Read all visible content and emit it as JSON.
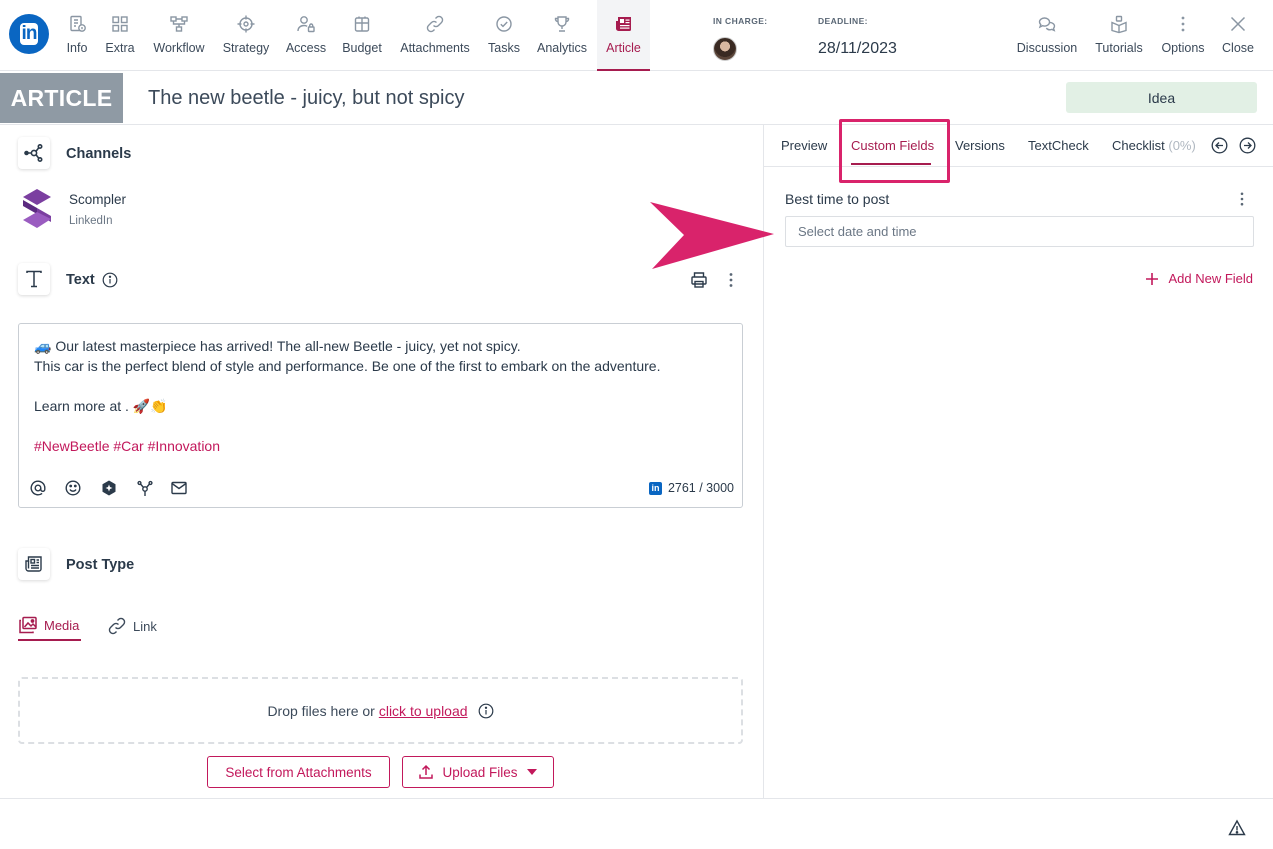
{
  "colors": {
    "accent": "#a61c4f",
    "pink": "#c2185b",
    "highlight": "#d9236b",
    "linkedin": "#0a66c2",
    "status_bg": "#e2f0e5",
    "badge_bg": "#8f9aa4"
  },
  "toolbar": {
    "logo_icon": "linkedin-icon",
    "logo_text": "in",
    "nav": [
      {
        "label": "Info",
        "icon": "info-document-icon"
      },
      {
        "label": "Extra",
        "icon": "grid-icon"
      },
      {
        "label": "Workflow",
        "icon": "workflow-icon"
      },
      {
        "label": "Strategy",
        "icon": "target-icon"
      },
      {
        "label": "Access",
        "icon": "user-lock-icon"
      },
      {
        "label": "Budget",
        "icon": "budget-icon"
      },
      {
        "label": "Attachments",
        "icon": "link-icon"
      },
      {
        "label": "Tasks",
        "icon": "check-circle-icon"
      },
      {
        "label": "Analytics",
        "icon": "trophy-icon"
      },
      {
        "label": "Article",
        "icon": "newspaper-icon",
        "active": true
      }
    ],
    "in_charge_label": "IN CHARGE:",
    "deadline_label": "DEADLINE:",
    "deadline_value": "28/11/2023",
    "actions": [
      {
        "label": "Discussion",
        "icon": "chat-icon"
      },
      {
        "label": "Tutorials",
        "icon": "tutorial-icon"
      },
      {
        "label": "Options",
        "icon": "kebab-icon"
      },
      {
        "label": "Close",
        "icon": "close-icon"
      }
    ]
  },
  "header": {
    "type_badge": "ARTICLE",
    "title": "The new beetle - juicy, but not spicy",
    "status": "Idea"
  },
  "channels": {
    "title": "Channels",
    "items": [
      {
        "name": "Scompler",
        "network": "LinkedIn"
      }
    ]
  },
  "text_section": {
    "title": "Text",
    "lines": [
      "🚙 Our latest masterpiece has arrived! The all-new Beetle - juicy, yet not spicy.",
      "This car is the perfect blend of style and performance. Be one of the first to embark on the adventure.",
      "Learn more at . 🚀👏"
    ],
    "hashtags": "#NewBeetle #Car #Innovation",
    "char_count": "2761 / 3000"
  },
  "post_type": {
    "title": "Post Type",
    "tabs": [
      {
        "label": "Media",
        "active": true
      },
      {
        "label": "Link"
      }
    ],
    "drop_text": "Drop files here or",
    "upload_link": "click to upload",
    "select_button": "Select from Attachments",
    "upload_button": "Upload Files"
  },
  "right_panel": {
    "tabs": [
      {
        "label": "Preview"
      },
      {
        "label": "Custom Fields",
        "active": true
      },
      {
        "label": "Versions"
      },
      {
        "label": "TextCheck"
      },
      {
        "label": "Checklist"
      }
    ],
    "checklist_progress": "(0%)",
    "field_label": "Best time to post",
    "field_placeholder": "Select date and time",
    "add_field": "Add New Field"
  }
}
